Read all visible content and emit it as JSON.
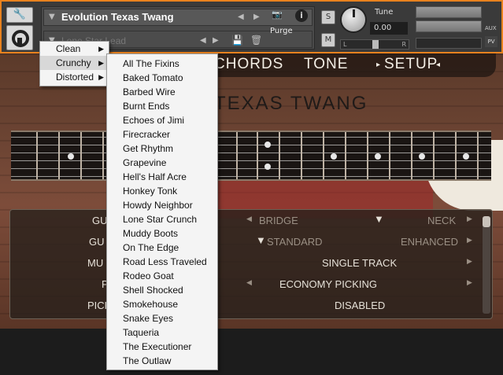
{
  "header": {
    "instrument_name": "Evolution Texas Twang",
    "preset_name": "Lone Star Lead",
    "purge_label": "Purge",
    "solo_label": "S",
    "mute_label": "M",
    "tune_label": "Tune",
    "tune_value": "0.00",
    "pan_left": "L",
    "pan_right": "R",
    "aux_label": "AUX",
    "pv_label": "PV"
  },
  "tabs": [
    "CHORDS",
    "TONE",
    "SETUP"
  ],
  "instrument_title": "TEXAS TWANG",
  "controls": {
    "row1": {
      "label": "GU",
      "left": "BRIDGE",
      "right": "NECK"
    },
    "row2": {
      "label": "GU",
      "left": "STANDARD",
      "right": "ENHANCED"
    },
    "row3": {
      "label": "MU",
      "value": "SINGLE TRACK"
    },
    "row4": {
      "label": "P",
      "value": "ECONOMY PICKING"
    },
    "row5": {
      "label": "PICK",
      "value": "DISABLED"
    }
  },
  "category_menu": {
    "items": [
      {
        "label": "Clean"
      },
      {
        "label": "Crunchy"
      },
      {
        "label": "Distorted"
      }
    ],
    "selected": "Crunchy"
  },
  "preset_menu": {
    "items": [
      "All The Fixins",
      "Baked Tomato",
      "Barbed Wire",
      "Burnt Ends",
      "Echoes of Jimi",
      "Firecracker",
      "Get Rhythm",
      "Grapevine",
      "Hell's Half Acre",
      "Honkey Tonk",
      "Howdy Neighbor",
      "Lone Star Crunch",
      "Muddy Boots",
      "On The Edge",
      "Road Less Traveled",
      "Rodeo Goat",
      "Shell Shocked",
      "Smokehouse",
      "Snake Eyes",
      "Taqueria",
      "The Executioner",
      "The Outlaw"
    ]
  },
  "colors": {
    "accent": "#e8821e",
    "menu_bg": "#f4f4f4"
  }
}
